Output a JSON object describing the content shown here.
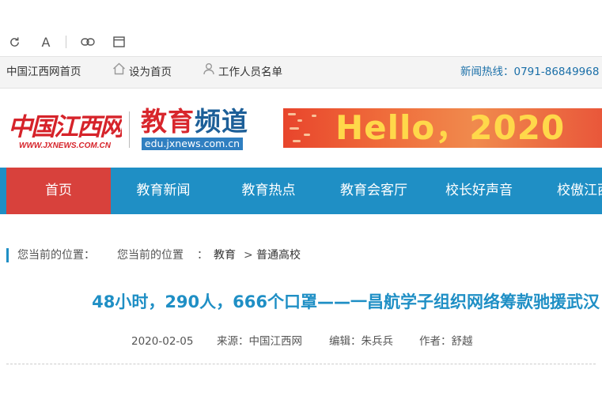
{
  "toolbar": {
    "icons": [
      "refresh-icon",
      "font-icon",
      "link-icon",
      "window-icon"
    ],
    "font_glyph": "A"
  },
  "utilbar": {
    "home_link": "中国江西网首页",
    "set_homepage": "设为首页",
    "staff_list": "工作人员名单",
    "hotline": "新闻热线：0791-86849968"
  },
  "header": {
    "logo_cn_text": "中国江西网",
    "logo_cn_url": "WWW.JXNEWS.COM.CN",
    "edu_title_red": "教育",
    "edu_title_blue": "频道",
    "edu_url": "edu.jxnews.com.cn",
    "banner_text": "Hello，2020"
  },
  "nav": {
    "items": [
      {
        "label": "首页"
      },
      {
        "label": "教育新闻"
      },
      {
        "label": "教育热点"
      },
      {
        "label": "教育会客厅"
      },
      {
        "label": "校长好声音"
      },
      {
        "label": "校傲江西"
      }
    ],
    "colors": {
      "bar": "#1f8fc5",
      "active": "#d8413c"
    }
  },
  "breadcrumb": {
    "label": "您当前的位置：",
    "label2": "您当前的位置",
    "sep": "：",
    "level1": "教育",
    "arrow": ">",
    "level2": "普通高校"
  },
  "article": {
    "title": "48小时，290人，666个口罩——一昌航学子组织网络筹款驰援武汉",
    "date": "2020-02-05",
    "source": "来源：中国江西网",
    "editor": "编辑：朱兵兵",
    "author": "作者：舒越"
  }
}
